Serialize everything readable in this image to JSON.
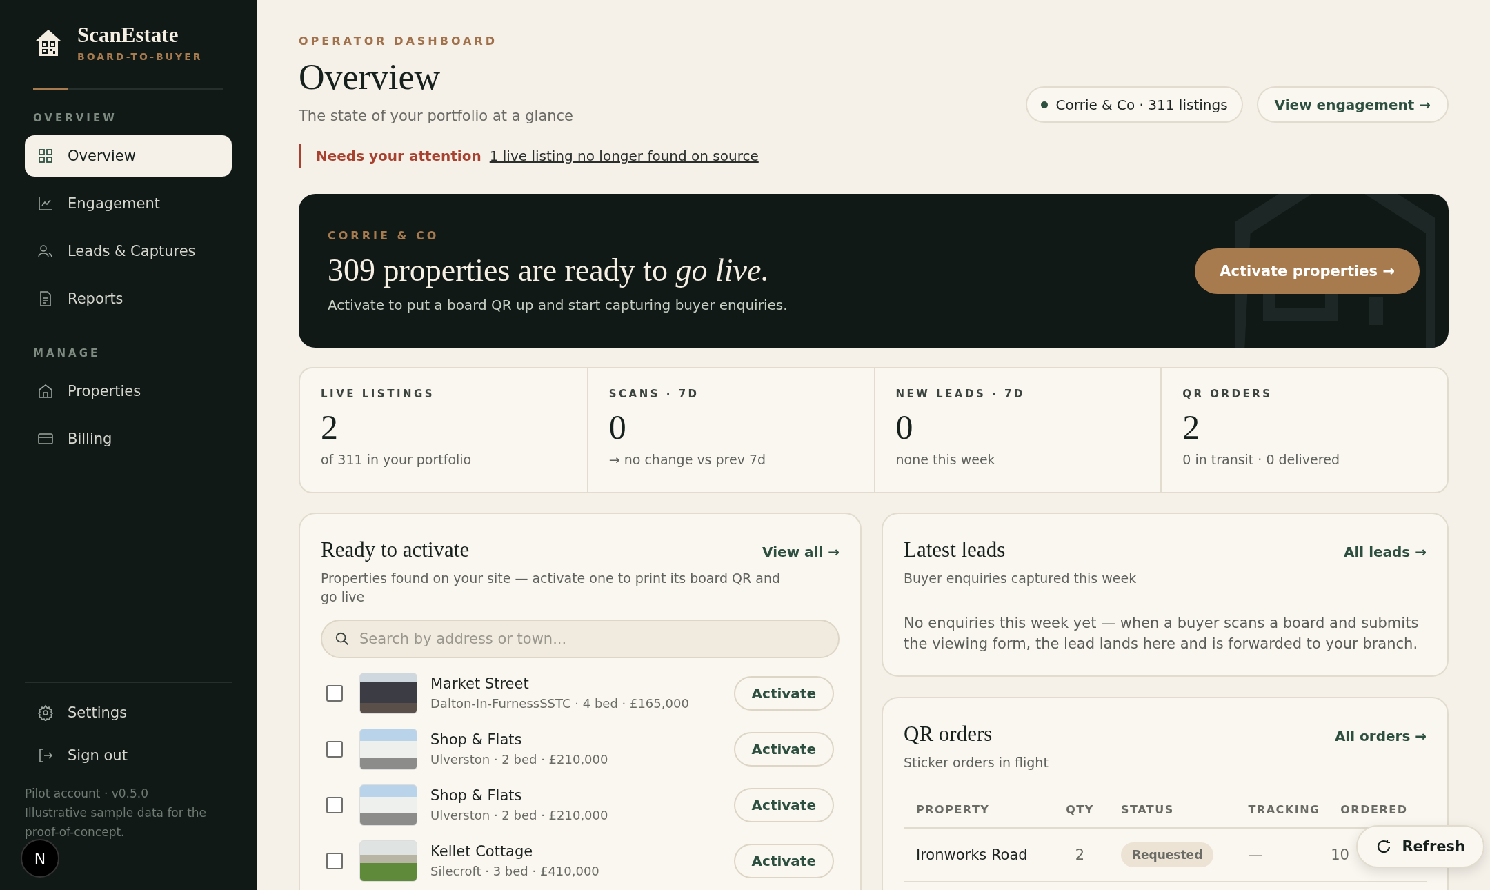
{
  "brand": {
    "name": "ScanEstate",
    "tagline": "BOARD-TO-BUYER"
  },
  "sidebar": {
    "sections": [
      {
        "heading": "OVERVIEW",
        "items": [
          {
            "label": "Overview",
            "selected": true
          },
          {
            "label": "Engagement",
            "selected": false
          },
          {
            "label": "Leads & Captures",
            "selected": false
          },
          {
            "label": "Reports",
            "selected": false
          }
        ]
      },
      {
        "heading": "MANAGE",
        "items": [
          {
            "label": "Properties",
            "selected": false
          },
          {
            "label": "Billing",
            "selected": false
          }
        ]
      }
    ],
    "footer_items": [
      {
        "label": "Settings"
      },
      {
        "label": "Sign out"
      }
    ],
    "version": "Pilot account · v0.5.0",
    "footnote": "Illustrative sample data for the proof-of-concept."
  },
  "header": {
    "eyebrow": "OPERATOR DASHBOARD",
    "title": "Overview",
    "subtitle": "The state of your portfolio at a glance",
    "account": "Corrie & Co · 311 listings",
    "button": "View engagement →"
  },
  "attention": {
    "label": "Needs your attention",
    "link": "1 live listing no longer found on source"
  },
  "banner": {
    "eyebrow": "CORRIE & CO",
    "headline": "309 properties are ready to *go live.*",
    "text": "Activate to put a board QR up and start capturing buyer enquiries.",
    "button": "Activate properties →"
  },
  "stats": [
    {
      "label": "LIVE LISTINGS",
      "value": "2",
      "note": "of 311 in your portfolio"
    },
    {
      "label": "SCANS · 7D",
      "value": "0",
      "note": "→ no change vs prev 7d"
    },
    {
      "label": "NEW LEADS · 7D",
      "value": "0",
      "note": "none this week"
    },
    {
      "label": "QR ORDERS",
      "value": "2",
      "note": "0 in transit · 0 delivered"
    }
  ],
  "ready": {
    "title": "Ready to activate",
    "link": "View all →",
    "subtitle": "Properties found on your site — activate one to print its board QR and go live",
    "search": {
      "placeholder": "Search by address or town..."
    },
    "properties": [
      {
        "name": "Market Street",
        "details": "Dalton-In-FurnessSSTC · 4 bed · £165,000",
        "checked": false,
        "action": "Activate"
      },
      {
        "name": "Shop & Flats",
        "details": "Ulverston · 2 bed · £210,000",
        "checked": false,
        "action": "Activate"
      },
      {
        "name": "Shop & Flats",
        "details": "Ulverston · 2 bed · £210,000",
        "checked": false,
        "action": "Activate"
      },
      {
        "name": "Kellet Cottage",
        "details": "Silecroft · 3 bed · £410,000",
        "checked": false,
        "action": "Activate"
      }
    ]
  },
  "leads": {
    "title": "Latest leads",
    "link": "All leads →",
    "subtitle": "Buyer enquiries captured this week",
    "empty": "No enquiries this week yet — when a buyer scans a board and submits the viewing form, the lead lands here and is forwarded to your branch."
  },
  "orders": {
    "title": "QR orders",
    "link": "All orders →",
    "subtitle": "Sticker orders in flight",
    "columns": [
      "PROPERTY",
      "QTY",
      "STATUS",
      "TRACKING",
      "ORDERED"
    ],
    "rows": [
      {
        "property": "Ironworks Road",
        "qty": "2",
        "status": "Requested",
        "tracking": "—",
        "ordered": "10"
      }
    ]
  },
  "refresh": {
    "label": "Refresh"
  },
  "dev_badge": "N"
}
